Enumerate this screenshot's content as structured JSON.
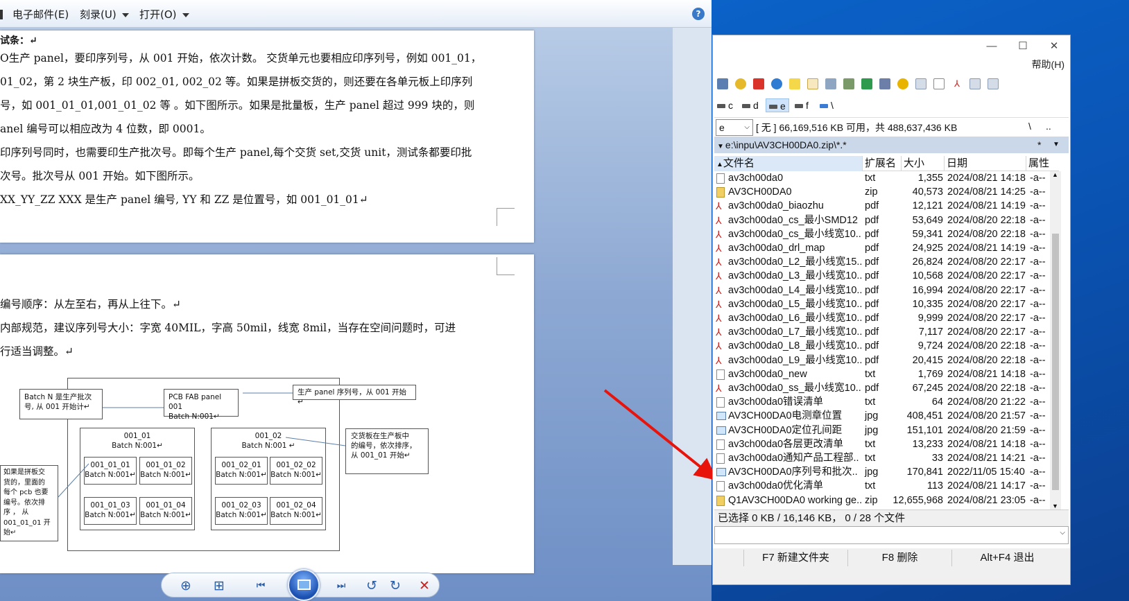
{
  "viewer": {
    "menu": {
      "email": "电子邮件(E)",
      "burn": "刻录(U)",
      "open": "打开(O)"
    },
    "help_icon": "?",
    "page1_lines": [
      "试条：↵",
      "O生产 panel，要印序列号，从 001 开始，依次计数。 交货单元也要相应印序列号，例如 001_01，",
      "01_02，第 2 块生产板，印 002_01, 002_02 等。如果是拼板交货的，则还要在各单元板上印序列",
      "号，如 001_01_01,001_01_02 等 。如下图所示。如果是批量板，生产 panel 超过 999 块的，则",
      "anel 编号可以相应改为 4 位数，即 0001。",
      "印序列号同时，也需要印生产批次号。即每个生产 panel,每个交货 set,交货 unit，测试条都要印批",
      "次号。批次号从 001 开始。如下图所示。",
      "XX_YY_ZZ    XXX  是生产 panel 编号, YY  和  ZZ    是位置号，如 001_01_01↵"
    ],
    "page2_lines": [
      "编号顺序：从左至右，再从上往下。↵",
      "内部规范，建议序列号大小：字宽 40MIL，字高 50mil，线宽 8mil，当存在空间问题时，可进",
      "行适当调整。↵"
    ],
    "diagram": {
      "batch_note": [
        "Batch  N  是生产批次",
        "号, 从 001 开始计↵"
      ],
      "pcb_panel": [
        "PCB FAB panel 001",
        "Batch N:001↵"
      ],
      "panel_note": "生产 panel  序列号，从 001 开始↵",
      "set_left": [
        "001_01",
        "Batch N:001↵"
      ],
      "set_right": [
        "001_02",
        "Batch N:001 ↵"
      ],
      "set_note": [
        "交货板在生产板中",
        "的编号，依次排序，",
        "从 001_01 开始↵"
      ],
      "units": [
        [
          "001_01_01",
          "Batch N:001↵"
        ],
        [
          "001_01_02",
          "Batch N:001↵"
        ],
        [
          "001_01_03",
          "Batch N:001↵"
        ],
        [
          "001_01_04",
          "Batch N:001↵"
        ],
        [
          "001_02_01",
          "Batch N:001↵"
        ],
        [
          "001_02_02",
          "Batch N:001↵"
        ],
        [
          "001_02_03",
          "Batch N:001↵"
        ],
        [
          "001_02_04",
          "Batch N:001↵"
        ]
      ],
      "unit_note": [
        "如果是拼板交",
        "货的，里面的",
        "每个 pcb 也要",
        "编号。依次排",
        "序    ，    从",
        "001_01_01   开",
        "始↵"
      ]
    },
    "toolbar_icons": [
      "zoom-icon",
      "fit-icon",
      "previous-icon",
      "slideshow-icon",
      "next-icon",
      "rotate-left-icon",
      "rotate-right-icon",
      "delete-icon"
    ]
  },
  "explorer": {
    "window_buttons": {
      "minimize": "—",
      "maximize": "☐",
      "close": "✕"
    },
    "help_menu": "帮助(H)",
    "drives": [
      "c",
      "d",
      "e",
      "f",
      "\\"
    ],
    "current_drive": "e",
    "drive_info": "[ 无 ]  66,169,516 KB 可用，共 488,637,436 KB",
    "nav_root": "\\",
    "nav_up": "..",
    "path": "e:\\inpu\\AV3CH00DA0.zip\\*.*",
    "path_star": "*",
    "columns": {
      "name": "文件名",
      "ext": "扩展名",
      "size": "大小",
      "date": "日期",
      "attr": "属性"
    },
    "files": [
      {
        "name": "av3ch00da0",
        "ext": "txt",
        "size": "1,355",
        "date": "2024/08/21 14:18",
        "attr": "-a--",
        "type": "txt"
      },
      {
        "name": "AV3CH00DA0",
        "ext": "zip",
        "size": "40,573",
        "date": "2024/08/21 14:25",
        "attr": "-a--",
        "type": "zip"
      },
      {
        "name": "av3ch00da0_biaozhu",
        "ext": "pdf",
        "size": "12,121",
        "date": "2024/08/21 14:19",
        "attr": "-a--",
        "type": "pdf"
      },
      {
        "name": "av3ch00da0_cs_最小SMD12",
        "ext": "pdf",
        "size": "53,649",
        "date": "2024/08/20 22:18",
        "attr": "-a--",
        "type": "pdf"
      },
      {
        "name": "av3ch00da0_cs_最小线宽10..",
        "ext": "pdf",
        "size": "59,341",
        "date": "2024/08/20 22:18",
        "attr": "-a--",
        "type": "pdf"
      },
      {
        "name": "av3ch00da0_drl_map",
        "ext": "pdf",
        "size": "24,925",
        "date": "2024/08/21 14:19",
        "attr": "-a--",
        "type": "pdf"
      },
      {
        "name": "av3ch00da0_L2_最小线宽15..",
        "ext": "pdf",
        "size": "26,824",
        "date": "2024/08/20 22:17",
        "attr": "-a--",
        "type": "pdf"
      },
      {
        "name": "av3ch00da0_L3_最小线宽10..",
        "ext": "pdf",
        "size": "10,568",
        "date": "2024/08/20 22:17",
        "attr": "-a--",
        "type": "pdf"
      },
      {
        "name": "av3ch00da0_L4_最小线宽10..",
        "ext": "pdf",
        "size": "16,994",
        "date": "2024/08/20 22:17",
        "attr": "-a--",
        "type": "pdf"
      },
      {
        "name": "av3ch00da0_L5_最小线宽10..",
        "ext": "pdf",
        "size": "10,335",
        "date": "2024/08/20 22:17",
        "attr": "-a--",
        "type": "pdf"
      },
      {
        "name": "av3ch00da0_L6_最小线宽10..",
        "ext": "pdf",
        "size": "9,999",
        "date": "2024/08/20 22:17",
        "attr": "-a--",
        "type": "pdf"
      },
      {
        "name": "av3ch00da0_L7_最小线宽10..",
        "ext": "pdf",
        "size": "7,117",
        "date": "2024/08/20 22:17",
        "attr": "-a--",
        "type": "pdf"
      },
      {
        "name": "av3ch00da0_L8_最小线宽10..",
        "ext": "pdf",
        "size": "9,724",
        "date": "2024/08/20 22:18",
        "attr": "-a--",
        "type": "pdf"
      },
      {
        "name": "av3ch00da0_L9_最小线宽10..",
        "ext": "pdf",
        "size": "20,415",
        "date": "2024/08/20 22:18",
        "attr": "-a--",
        "type": "pdf"
      },
      {
        "name": "av3ch00da0_new",
        "ext": "txt",
        "size": "1,769",
        "date": "2024/08/21 14:18",
        "attr": "-a--",
        "type": "txt"
      },
      {
        "name": "av3ch00da0_ss_最小线宽10..",
        "ext": "pdf",
        "size": "67,245",
        "date": "2024/08/20 22:18",
        "attr": "-a--",
        "type": "pdf"
      },
      {
        "name": "av3ch00da0错误清单",
        "ext": "txt",
        "size": "64",
        "date": "2024/08/20 21:22",
        "attr": "-a--",
        "type": "txt"
      },
      {
        "name": "AV3CH00DA0电测章位置",
        "ext": "jpg",
        "size": "408,451",
        "date": "2024/08/20 21:57",
        "attr": "-a--",
        "type": "jpg"
      },
      {
        "name": "AV3CH00DA0定位孔间距",
        "ext": "jpg",
        "size": "151,101",
        "date": "2024/08/20 21:59",
        "attr": "-a--",
        "type": "jpg"
      },
      {
        "name": "av3ch00da0各层更改清单",
        "ext": "txt",
        "size": "13,233",
        "date": "2024/08/21 14:18",
        "attr": "-a--",
        "type": "txt"
      },
      {
        "name": "av3ch00da0通知产品工程部..",
        "ext": "txt",
        "size": "33",
        "date": "2024/08/21 14:21",
        "attr": "-a--",
        "type": "txt"
      },
      {
        "name": "AV3CH00DA0序列号和批次..",
        "ext": "jpg",
        "size": "170,841",
        "date": "2022/11/05 15:40",
        "attr": "-a--",
        "type": "jpg"
      },
      {
        "name": "av3ch00da0优化清单",
        "ext": "txt",
        "size": "113",
        "date": "2024/08/21 14:17",
        "attr": "-a--",
        "type": "txt"
      },
      {
        "name": "Q1AV3CH00DA0 working ge..",
        "ext": "zip",
        "size": "12,655,968",
        "date": "2024/08/21 23:05",
        "attr": "-a--",
        "type": "zip"
      }
    ],
    "status": "已选择 0 KB / 16,146 KB，  0 / 28 个文件",
    "fkeys": [
      "F7 新建文件夹",
      "F8 删除",
      "Alt+F4 退出"
    ]
  },
  "colors": {
    "annotation_arrow": "#e8140c",
    "path_bar": "#cad8e9",
    "desktop": "#0b62c8"
  }
}
